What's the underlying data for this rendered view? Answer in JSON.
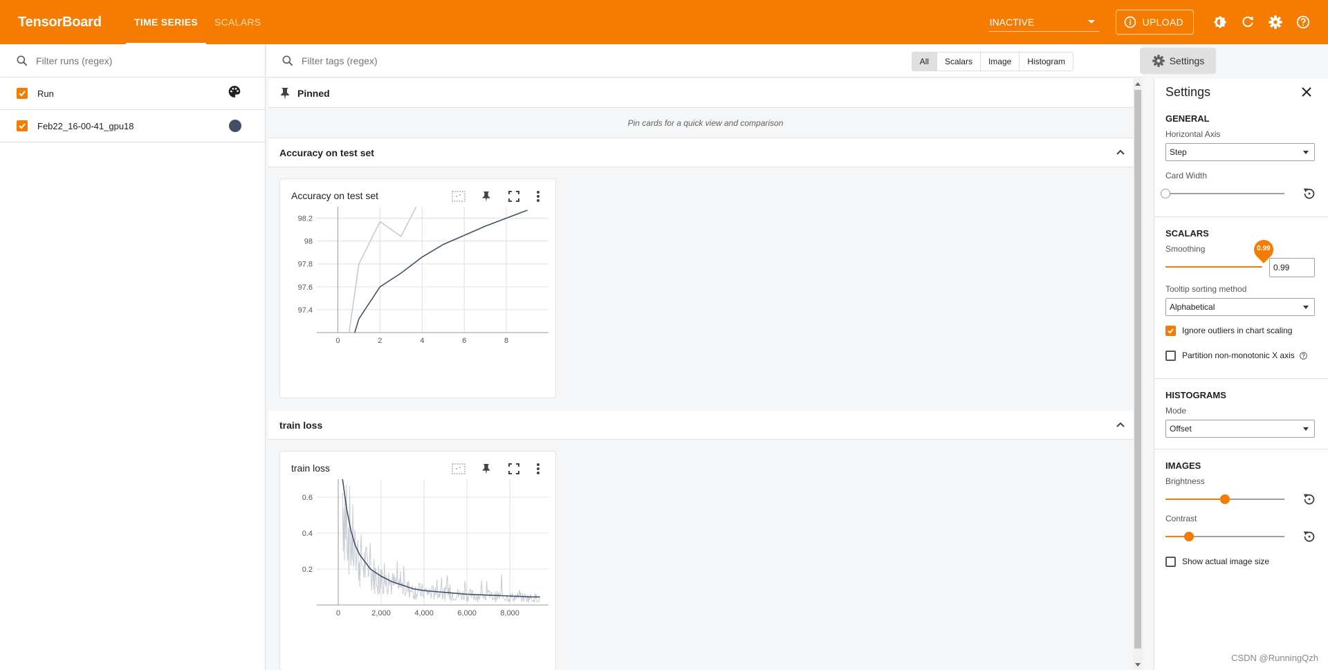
{
  "header": {
    "brand": "TensorBoard",
    "tabs": [
      {
        "label": "TIME SERIES",
        "active": true
      },
      {
        "label": "SCALARS",
        "active": false
      }
    ],
    "reload_state": "INACTIVE",
    "upload_label": "UPLOAD",
    "color": "#f57c00"
  },
  "runs": {
    "filter_placeholder": "Filter runs (regex)",
    "items": [
      {
        "label": "Run",
        "checked": true
      },
      {
        "label": "Feb22_16-00-41_gpu18",
        "checked": true,
        "color": "#425066"
      }
    ]
  },
  "main": {
    "tag_filter_placeholder": "Filter tags (regex)",
    "type_filters": [
      "All",
      "Scalars",
      "Image",
      "Histogram"
    ],
    "settings_button": "Settings",
    "pinned": {
      "title": "Pinned",
      "empty_text": "Pin cards for a quick view and comparison"
    },
    "groups": [
      {
        "title": "Accuracy on test set"
      },
      {
        "title": "train loss"
      }
    ]
  },
  "chart_data": [
    {
      "type": "line",
      "title": "Accuracy on test set",
      "x_ticks": [
        "0",
        "2",
        "4",
        "6",
        "8"
      ],
      "y_ticks": [
        "97.4",
        "97.6",
        "97.8",
        "98",
        "98.2"
      ],
      "xlim": [
        -1,
        10
      ],
      "ylim": [
        97.2,
        98.3
      ],
      "series": [
        {
          "values_x": [
            0.3,
            1,
            2,
            3,
            4
          ],
          "values_y": [
            96.9,
            97.8,
            98.17,
            98.04,
            98.4
          ],
          "color": "#c5cad6"
        },
        {
          "values_x": [
            0.8,
            1,
            2,
            3,
            4,
            5,
            6,
            7,
            8,
            9
          ],
          "values_y": [
            97.2,
            97.32,
            97.6,
            97.72,
            97.86,
            97.97,
            98.05,
            98.13,
            98.2,
            98.27
          ],
          "color": "#425066"
        }
      ]
    },
    {
      "type": "line",
      "title": "train loss",
      "x_ticks": [
        "0",
        "2,000",
        "4,000",
        "6,000",
        "8,000"
      ],
      "y_ticks": [
        "0.2",
        "0.4",
        "0.6"
      ],
      "xlim": [
        -1000,
        9800
      ],
      "ylim": [
        0,
        0.7
      ],
      "series": [
        {
          "values_x": [
            200,
            400,
            600,
            800,
            1000,
            1500,
            2000,
            2500,
            3000,
            3500,
            4000,
            5000,
            6000,
            7000,
            8000,
            9000,
            9400
          ],
          "values_y": [
            0.7,
            0.53,
            0.41,
            0.33,
            0.28,
            0.2,
            0.16,
            0.13,
            0.11,
            0.09,
            0.08,
            0.07,
            0.06,
            0.055,
            0.05,
            0.045,
            0.045
          ],
          "color": "#425066"
        }
      ]
    }
  ],
  "settings": {
    "title": "Settings",
    "general": {
      "heading": "GENERAL",
      "axis_label": "Horizontal Axis",
      "axis_value": "Step",
      "card_width_label": "Card Width",
      "card_width": 0
    },
    "scalars": {
      "heading": "SCALARS",
      "smoothing_label": "Smoothing",
      "smoothing_value": "0.99",
      "smoothing_fraction": 0.99,
      "tooltip_label": "Tooltip sorting method",
      "tooltip_value": "Alphabetical",
      "ignore_outliers": "Ignore outliers in chart scaling",
      "partition": "Partition non-monotonic X axis"
    },
    "histograms": {
      "heading": "HISTOGRAMS",
      "mode_label": "Mode",
      "mode_value": "Offset"
    },
    "images": {
      "heading": "IMAGES",
      "brightness_label": "Brightness",
      "brightness_fraction": 0.5,
      "contrast_label": "Contrast",
      "contrast_fraction": 0.2,
      "actual_size": "Show actual image size"
    }
  },
  "watermark": "CSDN @RunningQzh"
}
